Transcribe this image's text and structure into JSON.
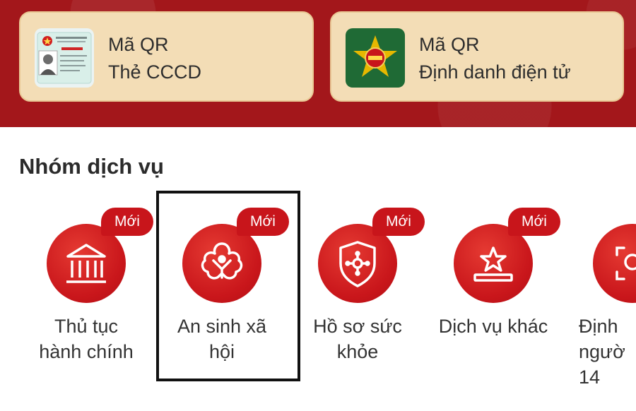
{
  "qr_cards": [
    {
      "line1": "Mã QR",
      "line2": "Thẻ CCCD",
      "icon": "id-card-icon"
    },
    {
      "line1": "Mã QR",
      "line2": "Định danh điện tử",
      "icon": "vneid-emblem-icon"
    }
  ],
  "section_title": "Nhóm dịch vụ",
  "services": [
    {
      "label_lines": [
        "Thủ tục",
        "hành chính"
      ],
      "badge": "Mới",
      "icon": "government-building-icon"
    },
    {
      "label_lines": [
        "An sinh xã",
        "hội"
      ],
      "badge": "Mới",
      "icon": "social-welfare-icon",
      "highlighted": true
    },
    {
      "label_lines": [
        "Hồ sơ sức",
        "khỏe"
      ],
      "badge": "Mới",
      "icon": "health-shield-icon"
    },
    {
      "label_lines": [
        "Dịch vụ khác",
        ""
      ],
      "badge": "Mới",
      "icon": "star-podium-icon"
    },
    {
      "label_lines": [
        "Định",
        "ngườ",
        "14"
      ],
      "badge": "",
      "icon": "face-scan-icon"
    }
  ],
  "colors": {
    "primary_red": "#c8151b",
    "banner_red": "#a3171b",
    "card_beige": "#f3ddb6"
  }
}
